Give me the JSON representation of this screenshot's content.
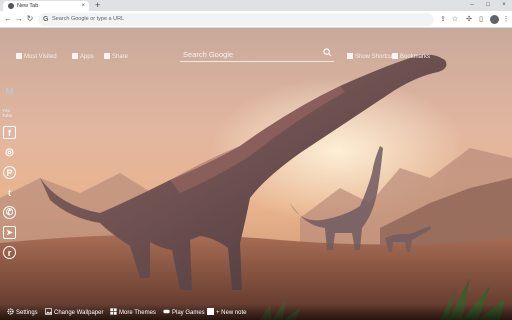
{
  "browser": {
    "tab_title": "New Tab",
    "tab_close": "×",
    "new_tab": "+",
    "omnibox_placeholder": "Search Google or type a URL",
    "back": "←",
    "forward": "→",
    "reload": "↻",
    "min": "–",
    "max": "□",
    "close": "×"
  },
  "topnav": {
    "most_visited": "Most Visited",
    "apps": "Apps",
    "share": "Share",
    "show_shortcuts": "Show Shortcuts",
    "bookmarks": "Bookmarks"
  },
  "search": {
    "placeholder": "Search Google"
  },
  "sidebar": {
    "items": [
      {
        "icon": "gmail-icon",
        "glyph": "M",
        "color": "#c5c5c5"
      },
      {
        "icon": "youtube-icon",
        "glyph": "You Tube",
        "color": "#e0e0e0"
      },
      {
        "icon": "facebook-icon",
        "glyph": "f",
        "color": "#ffffff"
      },
      {
        "icon": "instagram-icon",
        "glyph": "◎",
        "color": "#ffffff"
      },
      {
        "icon": "pinterest-icon",
        "glyph": "P",
        "color": "#ffffff"
      },
      {
        "icon": "twitter-icon",
        "glyph": "t",
        "color": "#ffffff"
      },
      {
        "icon": "whatsapp-icon",
        "glyph": "✆",
        "color": "#ffffff"
      },
      {
        "icon": "telegram-icon",
        "glyph": "➤",
        "color": "#ffffff"
      },
      {
        "icon": "reddit-icon",
        "glyph": "r",
        "color": "#ffffff"
      }
    ]
  },
  "bottombar": {
    "settings": "Settings",
    "change_wallpaper": "Change Wallpaper",
    "more_themes": "More Themes",
    "play_games": "Play Games",
    "new_note": "+ New note"
  },
  "colors": {
    "chrome_tabstrip": "#dfe1e5",
    "sky": "#e3a88a",
    "ground": "#8a5a48"
  }
}
